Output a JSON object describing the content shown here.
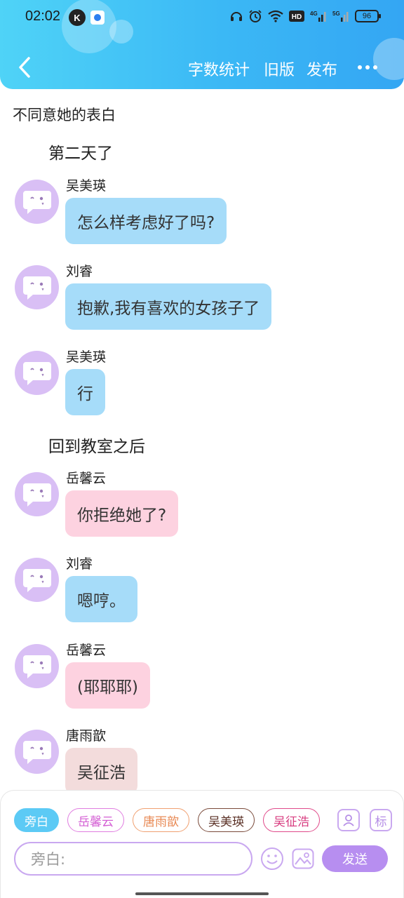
{
  "status_bar": {
    "time": "02:02",
    "battery": "96"
  },
  "header": {
    "actions": [
      "字数统计",
      "旧版",
      "发布"
    ]
  },
  "title": "不同意她的表白",
  "narrations": [
    "第二天了",
    "回到教室之后"
  ],
  "messages": [
    {
      "speaker": "吴美瑛",
      "text": "怎么样考虑好了吗?"
    },
    {
      "speaker": "刘睿",
      "text": "抱歉,我有喜欢的女孩子了"
    },
    {
      "speaker": "吴美瑛",
      "text": "行"
    },
    {
      "speaker": "岳馨云",
      "text": "你拒绝她了?"
    },
    {
      "speaker": "刘睿",
      "text": "嗯哼。"
    },
    {
      "speaker": "岳馨云",
      "text": "(耶耶耶)"
    },
    {
      "speaker": "唐雨歆",
      "text": "吴征浩"
    }
  ],
  "composer": {
    "chips": [
      "旁白",
      "岳馨云",
      "唐雨歆",
      "吴美瑛",
      "吴征浩"
    ],
    "mark_label": "标",
    "input_placeholder": "旁白:",
    "send_label": "发送"
  },
  "colors": {
    "accent": "#3bb8f5",
    "bubble_blue": "#a6dcf9",
    "bubble_pink": "#fdd2e0",
    "avatar": "#d9bff5",
    "send": "#b78ef0"
  }
}
